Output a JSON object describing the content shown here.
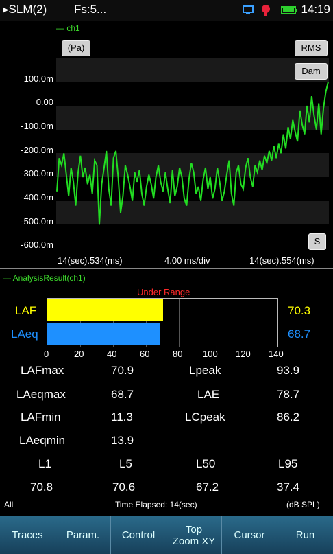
{
  "status": {
    "title": "▸SLM(2)",
    "fs": "Fs:5...",
    "time": "14:19",
    "icons": [
      "network-icon",
      "mic-icon",
      "battery-icon"
    ]
  },
  "scope": {
    "channel_legend": "— ch1",
    "unit_button": "(Pa)",
    "rms_button": "RMS",
    "dam_button": "Dam",
    "s_button": "S",
    "x_left": "14(sec).534(ms)",
    "x_mid": "4.00 ms/div",
    "x_right": "14(sec).554(ms)",
    "colors": {
      "trace": "#22dd22"
    }
  },
  "chart_data": {
    "type": "line",
    "ylim": [
      -0.7,
      0.2
    ],
    "yticks": [
      "100.0m",
      "0.00",
      "-100.0m",
      "-200.0m",
      "-300.0m",
      "-400.0m",
      "-500.0m",
      "-600.0m"
    ],
    "series": [
      {
        "values": [
          -0.46,
          -0.32,
          -0.35,
          -0.3,
          -0.39,
          -0.48,
          -0.36,
          -0.42,
          -0.52,
          -0.38,
          -0.31,
          -0.4,
          -0.36,
          -0.43,
          -0.39,
          -0.47,
          -0.33,
          -0.35,
          -0.6,
          -0.43,
          -0.36,
          -0.29,
          -0.45,
          -0.52,
          -0.32,
          -0.29,
          -0.4,
          -0.55,
          -0.48,
          -0.35,
          -0.39,
          -0.44,
          -0.5,
          -0.38,
          -0.42,
          -0.37,
          -0.47,
          -0.52,
          -0.44,
          -0.39,
          -0.43,
          -0.49,
          -0.4,
          -0.35,
          -0.42,
          -0.46,
          -0.38,
          -0.45,
          -0.51,
          -0.37,
          -0.48,
          -0.44,
          -0.36,
          -0.4,
          -0.49,
          -0.52,
          -0.41,
          -0.34,
          -0.38,
          -0.47,
          -0.44,
          -0.5,
          -0.41,
          -0.36,
          -0.45,
          -0.4,
          -0.49,
          -0.45,
          -0.36,
          -0.42,
          -0.5,
          -0.46,
          -0.39,
          -0.33,
          -0.47,
          -0.52,
          -0.38,
          -0.35,
          -0.43,
          -0.45,
          -0.36,
          -0.32,
          -0.4,
          -0.44,
          -0.35,
          -0.38,
          -0.33,
          -0.37,
          -0.31,
          -0.34,
          -0.29,
          -0.33,
          -0.27,
          -0.32,
          -0.26,
          -0.3,
          -0.22,
          -0.28,
          -0.19,
          -0.24,
          -0.16,
          -0.21,
          -0.25,
          -0.12,
          -0.18,
          -0.22,
          -0.1,
          -0.17,
          -0.06,
          -0.14,
          -0.2,
          -0.09,
          -0.22,
          -0.11,
          -0.04,
          0.0
        ]
      }
    ]
  },
  "analysis": {
    "legend": "— AnalysisResult(ch1)",
    "under_range": "Under Range",
    "bars": [
      {
        "label": "LAF",
        "value": 70.3,
        "display": "70.3",
        "color": "#ffff00"
      },
      {
        "label": "LAeq",
        "value": 68.7,
        "display": "68.7",
        "color": "#1e90ff"
      }
    ],
    "ticks": [
      "0",
      "20",
      "40",
      "60",
      "80",
      "100",
      "120",
      "140"
    ],
    "scale_max": 140,
    "stats": [
      {
        "name": "LAFmax",
        "value": "70.9",
        "name2": "Lpeak",
        "value2": "93.9"
      },
      {
        "name": "LAeqmax",
        "value": "68.7",
        "name2": "LAE",
        "value2": "78.7"
      },
      {
        "name": "LAFmin",
        "value": "11.3",
        "name2": "LCpeak",
        "value2": "86.2"
      },
      {
        "name": "LAeqmin",
        "value": "13.9",
        "name2": "",
        "value2": ""
      }
    ],
    "percentiles": {
      "labels": [
        "L1",
        "L5",
        "L50",
        "L95"
      ],
      "values": [
        "70.8",
        "70.6",
        "67.2",
        "37.4"
      ]
    },
    "footer_left": "All",
    "footer_mid": "Time Elapsed: 14(sec)",
    "footer_right": "(dB SPL)"
  },
  "toolbar": {
    "traces": "Traces",
    "param": "Param.",
    "control": "Control",
    "top": "Top",
    "zoom": "Zoom XY",
    "cursor": "Cursor",
    "run": "Run"
  }
}
